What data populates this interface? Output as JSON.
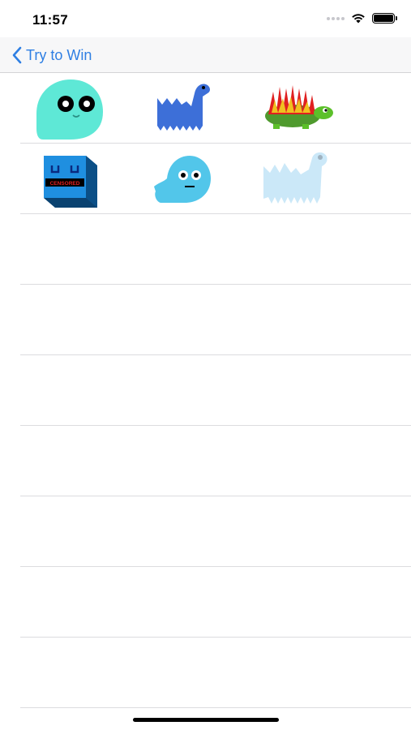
{
  "status_bar": {
    "time": "11:57",
    "icons": [
      "cellular-dots-icon",
      "wifi-icon",
      "battery-icon"
    ]
  },
  "nav": {
    "back_label": "Try to Win",
    "back_icon": "chevron-left-icon",
    "accent": "#2f7fe3"
  },
  "rows": [
    {
      "cells": [
        {
          "name": "ghost-blob-character"
        },
        {
          "name": "blue-dinosaur-character"
        },
        {
          "name": "spiky-turtle-character"
        }
      ]
    },
    {
      "cells": [
        {
          "name": "censored-cube-character",
          "badge_text": "CENSORED"
        },
        {
          "name": "smiling-ghost-character"
        },
        {
          "name": "faded-dinosaur-character"
        }
      ]
    },
    {
      "cells": []
    },
    {
      "cells": []
    },
    {
      "cells": []
    },
    {
      "cells": []
    },
    {
      "cells": []
    },
    {
      "cells": []
    },
    {
      "cells": []
    }
  ]
}
